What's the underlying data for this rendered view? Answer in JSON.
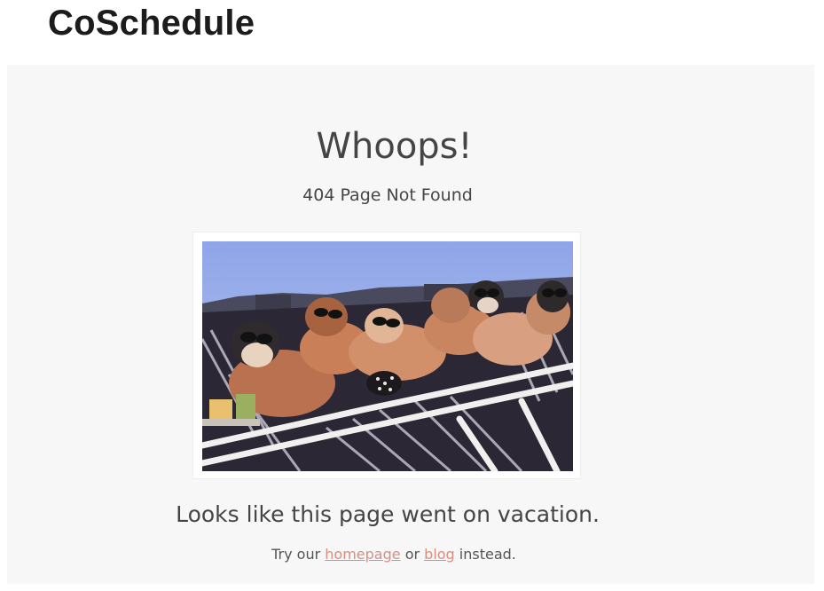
{
  "brand": {
    "name": "CoSchedule"
  },
  "error": {
    "heading": "Whoops!",
    "code_text": "404 Page Not Found",
    "image_icon": "sunbathing-dogs-image",
    "message": "Looks like this page went on vacation.",
    "suggestion": {
      "prefix": "Try our ",
      "homepage_link": "homepage",
      "middle": " or ",
      "blog_link": "blog",
      "suffix": " instead."
    }
  },
  "colors": {
    "panel_background": "#f7f7f7",
    "heading_text": "#454545",
    "link": "#d88f80"
  }
}
